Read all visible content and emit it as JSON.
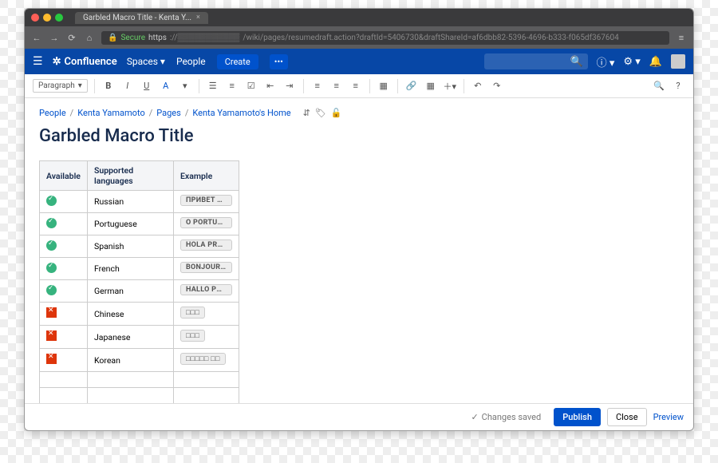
{
  "browser": {
    "tab_title": "Garbled Macro Title - Kenta Y...",
    "secure_label": "Secure",
    "url_scheme": "https",
    "url_path": "/wiki/pages/resumedraft.action?draftId=5406730&draftShareId=af6dbb82-5396-4696-b333-f065df367604"
  },
  "header": {
    "product": "Confluence",
    "nav_spaces": "Spaces",
    "nav_people": "People",
    "create": "Create",
    "more": "•••"
  },
  "toolbar": {
    "style": "Paragraph"
  },
  "breadcrumb": {
    "items": [
      "People",
      "Kenta Yamamoto",
      "Pages",
      "Kenta Yamamoto's Home"
    ]
  },
  "page": {
    "title": "Garbled Macro Title"
  },
  "table": {
    "headers": {
      "available": "Available",
      "supported": "Supported languages",
      "example": "Example"
    },
    "rows": [
      {
        "ok": true,
        "lang": "Russian",
        "ex": "ПРИВЕТ УЧ…"
      },
      {
        "ok": true,
        "lang": "Portuguese",
        "ex": "O PORTUG…"
      },
      {
        "ok": true,
        "lang": "Spanish",
        "ex": "HOLA PROF…"
      },
      {
        "ok": true,
        "lang": "French",
        "ex": "BONJOUR P…"
      },
      {
        "ok": true,
        "lang": "German",
        "ex": "HALLO PRO…"
      },
      {
        "ok": false,
        "lang": "Chinese",
        "ex": "□□□"
      },
      {
        "ok": false,
        "lang": "Japanese",
        "ex": "□□□"
      },
      {
        "ok": false,
        "lang": "Korean",
        "ex": "□□□□□ □□"
      }
    ]
  },
  "footer": {
    "saved": "Changes saved",
    "publish": "Publish",
    "close": "Close",
    "preview": "Preview"
  }
}
